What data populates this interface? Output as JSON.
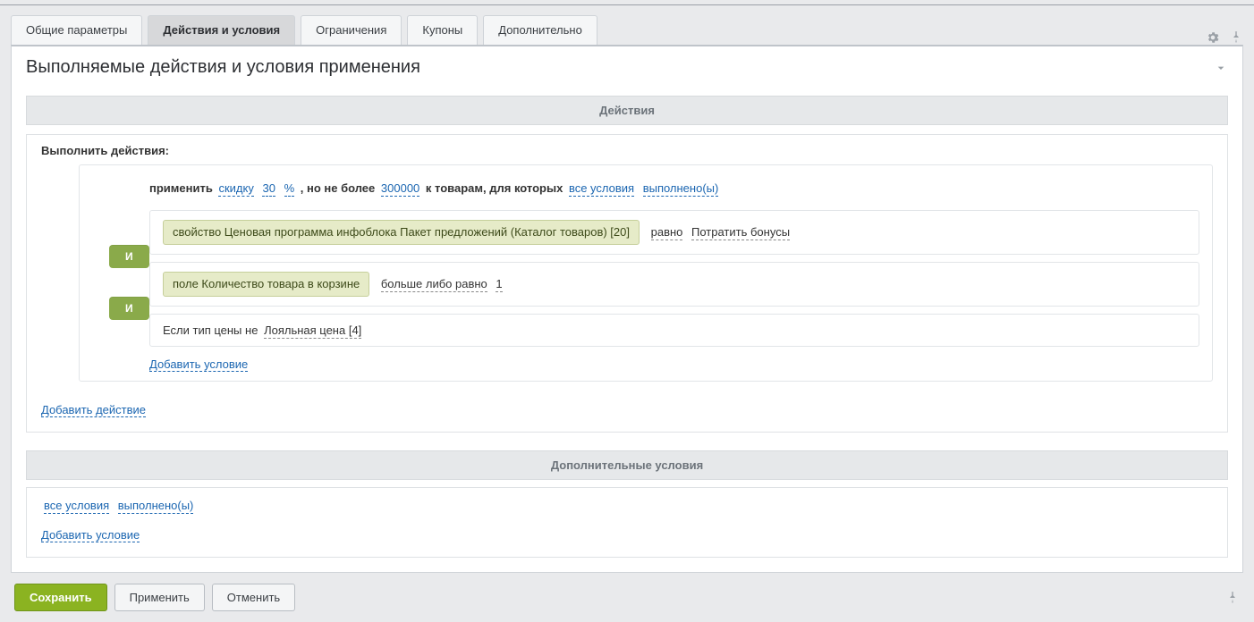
{
  "tabs": {
    "t0": "Общие параметры",
    "t1": "Действия и условия",
    "t2": "Ограничения",
    "t3": "Купоны",
    "t4": "Дополнительно"
  },
  "header": {
    "title": "Выполняемые действия и условия применения"
  },
  "sections": {
    "actions": "Действия",
    "additional": "Дополнительные условия"
  },
  "actions": {
    "perform_label": "Выполнить действия:",
    "apply_text": "применить",
    "discount_word": "скидку",
    "discount_value": "30",
    "discount_unit": "%",
    "max_prefix": ", но не более",
    "max_value": "300000",
    "to_goods": "к товарам, для которых",
    "all_conditions": "все условия",
    "fulfilled": "выполнено(ы)",
    "cond1_chip": "свойство Ценовая программа инфоблока Пакет предложений (Каталог товаров) [20]",
    "cond1_op": "равно",
    "cond1_val": "Потратить бонусы",
    "cond2_chip": "поле Количество товара в корзине",
    "cond2_op": "больше либо равно",
    "cond2_val": "1",
    "cond3_text": "Если тип цены не",
    "cond3_val": "Лояльная цена [4]",
    "and_pill": "И",
    "add_condition": "Добавить условие",
    "add_action": "Добавить действие"
  },
  "extra": {
    "all_conditions": "все условия",
    "fulfilled": "выполнено(ы)",
    "add_condition": "Добавить условие"
  },
  "buttons": {
    "save": "Сохранить",
    "apply": "Применить",
    "cancel": "Отменить"
  }
}
